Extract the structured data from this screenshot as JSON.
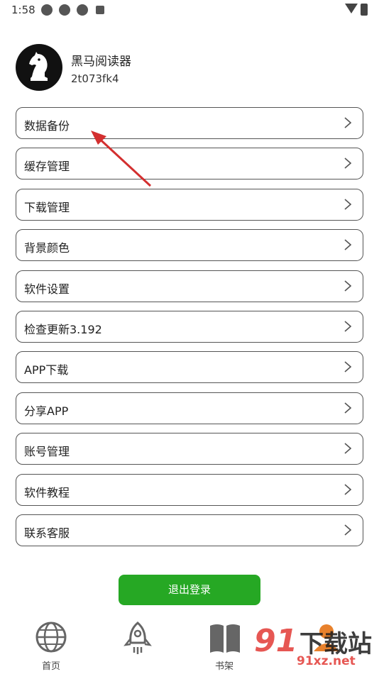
{
  "status_bar": {
    "time": "1:58"
  },
  "profile": {
    "name": "黑马阅读器",
    "id": "2t073fk4"
  },
  "menu": [
    {
      "label": "数据备份"
    },
    {
      "label": "缓存管理"
    },
    {
      "label": "下载管理"
    },
    {
      "label": "背景颜色"
    },
    {
      "label": "软件设置"
    },
    {
      "label": "检查更新3.192"
    },
    {
      "label": "APP下载"
    },
    {
      "label": "分享APP"
    },
    {
      "label": "账号管理"
    },
    {
      "label": "软件教程"
    },
    {
      "label": "联系客服"
    }
  ],
  "logout_label": "退出登录",
  "tabs": [
    {
      "label": "首页",
      "icon": "globe-icon"
    },
    {
      "label": "",
      "icon": "rocket-icon"
    },
    {
      "label": "书架",
      "icon": "book-icon"
    },
    {
      "label": "",
      "icon": "person-icon"
    }
  ],
  "watermark": {
    "brand": "91",
    "text": "下载站",
    "url": "91xz.net"
  },
  "colors": {
    "accent": "#26a824",
    "arrow": "#d32f2f",
    "watermark": "#e23a36"
  }
}
